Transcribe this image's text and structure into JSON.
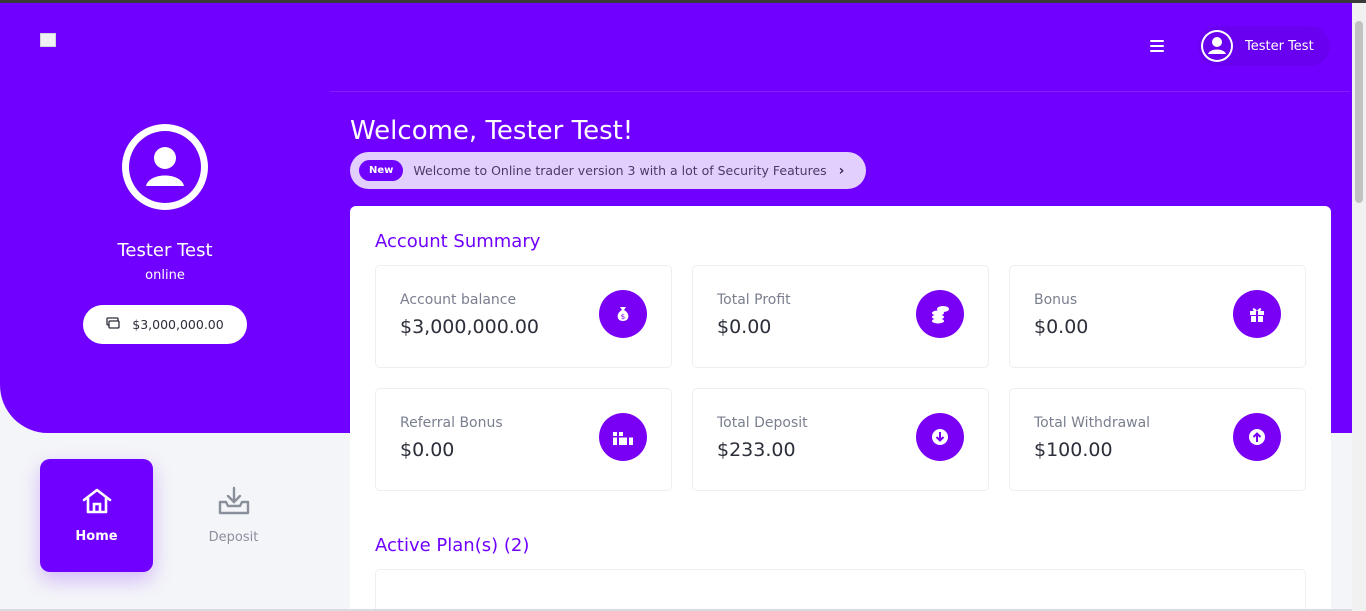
{
  "header": {
    "user_name": "Tester Test"
  },
  "profile": {
    "name": "Tester Test",
    "status": "online",
    "balance": "$3,000,000.00"
  },
  "welcome": {
    "title": "Welcome, Tester Test!",
    "announcement_badge": "New",
    "announcement_text": "Welcome to Online trader version 3 with a lot of Security Features"
  },
  "summary": {
    "title": "Account Summary",
    "items": [
      {
        "label": "Account balance",
        "value": "$3,000,000.00",
        "icon": "money-bag-icon"
      },
      {
        "label": "Total Profit",
        "value": "$0.00",
        "icon": "coins-icon"
      },
      {
        "label": "Bonus",
        "value": "$0.00",
        "icon": "gift-icon"
      },
      {
        "label": "Referral Bonus",
        "value": "$0.00",
        "icon": "gifts-icon"
      },
      {
        "label": "Total Deposit",
        "value": "$233.00",
        "icon": "arrow-down-circle-icon"
      },
      {
        "label": "Total Withdrawal",
        "value": "$100.00",
        "icon": "arrow-up-circle-icon"
      }
    ]
  },
  "plans": {
    "title": "Active Plan(s) (2)"
  },
  "nav": {
    "home": "Home",
    "deposit": "Deposit"
  },
  "colors": {
    "brand": "#7000ff",
    "announcement_bg": "#e3cffe",
    "page_bg": "#f4f5f8"
  }
}
